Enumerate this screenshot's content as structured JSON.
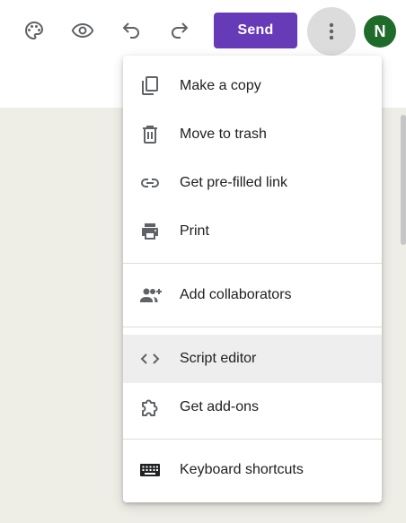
{
  "toolbar": {
    "icons": [
      {
        "name": "palette-icon",
        "title": "Customize theme"
      },
      {
        "name": "eye-icon",
        "title": "Preview"
      },
      {
        "name": "undo-icon",
        "title": "Undo"
      },
      {
        "name": "redo-icon",
        "title": "Redo"
      }
    ],
    "send_label": "Send",
    "more_icon": "more-vert-icon",
    "avatar_initial": "N",
    "accent_color": "#673ab7",
    "avatar_color": "#1f6b2a"
  },
  "menu": {
    "items": [
      {
        "label": "Make a copy",
        "icon": "copy-icon"
      },
      {
        "label": "Move to trash",
        "icon": "trash-icon"
      },
      {
        "label": "Get pre-filled link",
        "icon": "link-icon"
      },
      {
        "label": "Print",
        "icon": "print-icon"
      },
      {
        "label": "Add collaborators",
        "icon": "add-people-icon"
      },
      {
        "label": "Script editor",
        "icon": "code-icon",
        "highlighted": true
      },
      {
        "label": "Get add-ons",
        "icon": "puzzle-icon"
      },
      {
        "label": "Keyboard shortcuts",
        "icon": "keyboard-icon"
      }
    ]
  }
}
